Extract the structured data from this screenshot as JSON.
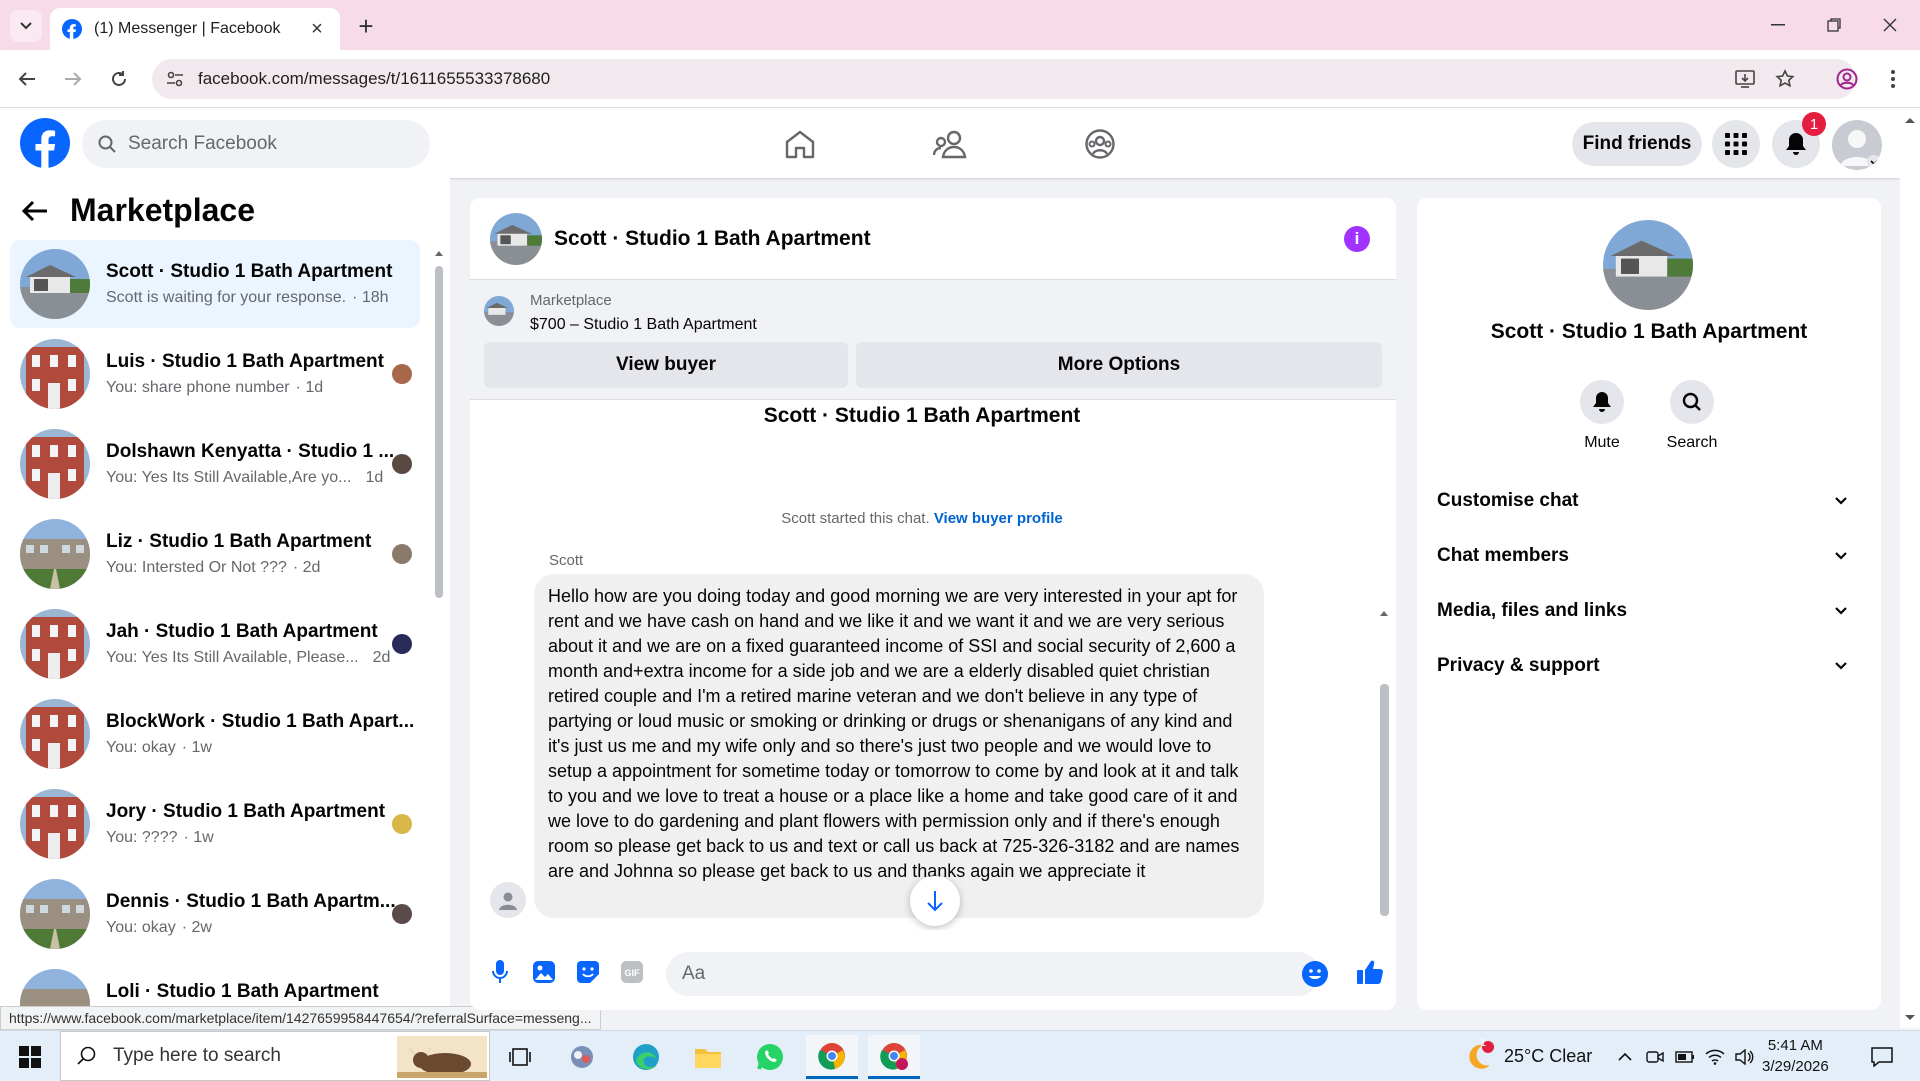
{
  "browser": {
    "tab_title": "(1) Messenger | Facebook",
    "url": "facebook.com/messages/t/1611655533378680",
    "status_url": "https://www.facebook.com/marketplace/item/1427659958447654/?referralSurface=messeng..."
  },
  "header": {
    "search_placeholder": "Search Facebook",
    "find_friends_label": "Find friends",
    "notification_count": "1"
  },
  "sidebar": {
    "title": "Marketplace",
    "conversations": [
      {
        "name": "Scott · Studio 1 Bath Apartment",
        "preview": "Scott is waiting for your response.",
        "time": "· 18h"
      },
      {
        "name": "Luis · Studio 1 Bath Apartment",
        "preview": "You: share phone number",
        "time": "· 1d"
      },
      {
        "name": "Dolshawn Kenyatta · Studio 1 ...",
        "preview": "You: Yes Its Still Available,Are yo...",
        "time": "1d"
      },
      {
        "name": "Liz · Studio 1 Bath Apartment",
        "preview": "You: Intersted Or Not ???",
        "time": "· 2d"
      },
      {
        "name": "Jah · Studio 1 Bath Apartment",
        "preview": "You: Yes Its Still Available, Please...",
        "time": "2d"
      },
      {
        "name": "BlockWork · Studio 1 Bath Apart...",
        "preview": "You: okay",
        "time": "· 1w"
      },
      {
        "name": "Jory · Studio 1 Bath Apartment",
        "preview": "You: ????",
        "time": "· 1w"
      },
      {
        "name": "Dennis · Studio 1 Bath Apartm...",
        "preview": "You: okay",
        "time": "· 2w"
      },
      {
        "name": "Loli · Studio 1 Bath Apartment",
        "preview": "",
        "time": ""
      }
    ]
  },
  "chat": {
    "title": "Scott · Studio 1 Bath Apartment",
    "marketplace_label": "Marketplace",
    "listing": "$700 – Studio 1 Bath Apartment",
    "view_buyer_label": "View buyer",
    "more_options_label": "More Options",
    "thread_title": "Scott · Studio 1 Bath Apartment",
    "started_text": "Scott started this chat.",
    "view_buyer_profile_label": "View buyer profile",
    "sender": "Scott",
    "message": "Hello how are you doing today and good morning we are very interested in your apt for rent and we have cash on hand and we like it and we want it and we are very serious about it and we are on a fixed guaranteed income of SSI and social security of 2,600 a month and+extra income for a side job and we are a elderly disabled quiet christian retired couple and I'm a retired marine veteran and we don't believe in any type of partying or loud music or smoking or drinking or drugs or shenanigans of any kind and it's just us me and my wife only and so there's just two people and we would love to setup a appointment for sometime today or tomorrow to come by and look at it and talk to you and we love to treat a house or a place like a home and take good care of it and we love to do gardening and plant flowers with permission only and if there's enough room so please get back to us and text or call us back at 725-326-3182 and are names are      and Johnna so please get back to us and thanks again we appreciate it",
    "input_placeholder": "Aa"
  },
  "right_panel": {
    "name": "Scott · Studio 1 Bath Apartment",
    "mute_label": "Mute",
    "search_label": "Search",
    "sections": [
      "Customise chat",
      "Chat members",
      "Media, files and links",
      "Privacy & support"
    ]
  },
  "taskbar": {
    "search_placeholder": "Type here to search",
    "weather": "25°C  Clear",
    "weather_badge": "1",
    "time": "5:41 AM",
    "date": "3/29/2026"
  },
  "colors": {
    "fb_blue": "#0866ff",
    "accent_purple": "#a033ff",
    "notif_red": "#e41e3f",
    "active_row": "#ebf5ff"
  }
}
